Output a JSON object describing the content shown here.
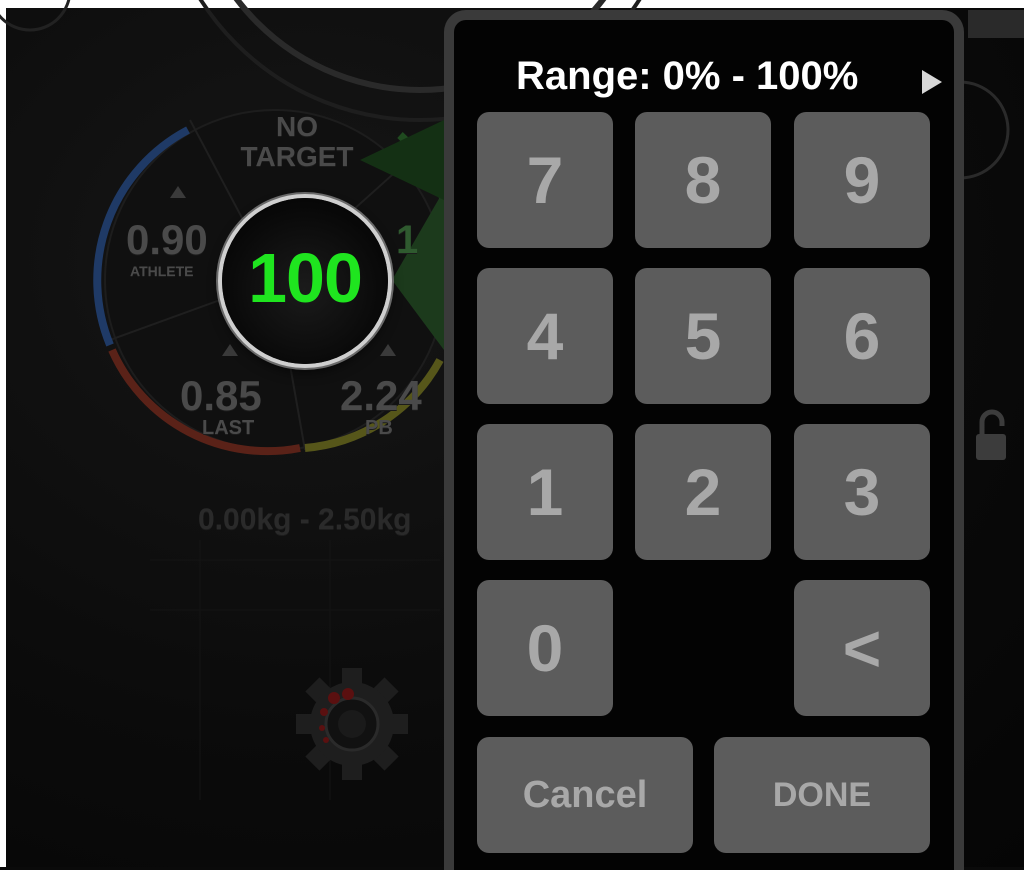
{
  "dial": {
    "target_label": "NO\nTARGET",
    "athlete_value": "0.90",
    "athlete_label": "ATHLETE",
    "partial_value": "1",
    "last_value": "0.85",
    "last_label": "LAST",
    "pb_value": "2.24",
    "pb_label": "PB",
    "current_value": "100",
    "weight_range": "0.00kg - 2.50kg"
  },
  "keypad": {
    "range_label": "Range: 0% - 100%",
    "keys": [
      "7",
      "8",
      "9",
      "4",
      "5",
      "6",
      "1",
      "2",
      "3",
      "0",
      "<"
    ],
    "cancel_label": "Cancel",
    "done_label": "DONE"
  },
  "icons": {
    "range_arrow": "play-arrow-icon",
    "settings": "gear-icon",
    "lock": "unlock-icon"
  },
  "colors": {
    "value_green": "#1fe51f",
    "key_bg": "#5c5c5c",
    "key_text": "#a8a8a8",
    "panel_border": "#3a3a3a"
  }
}
